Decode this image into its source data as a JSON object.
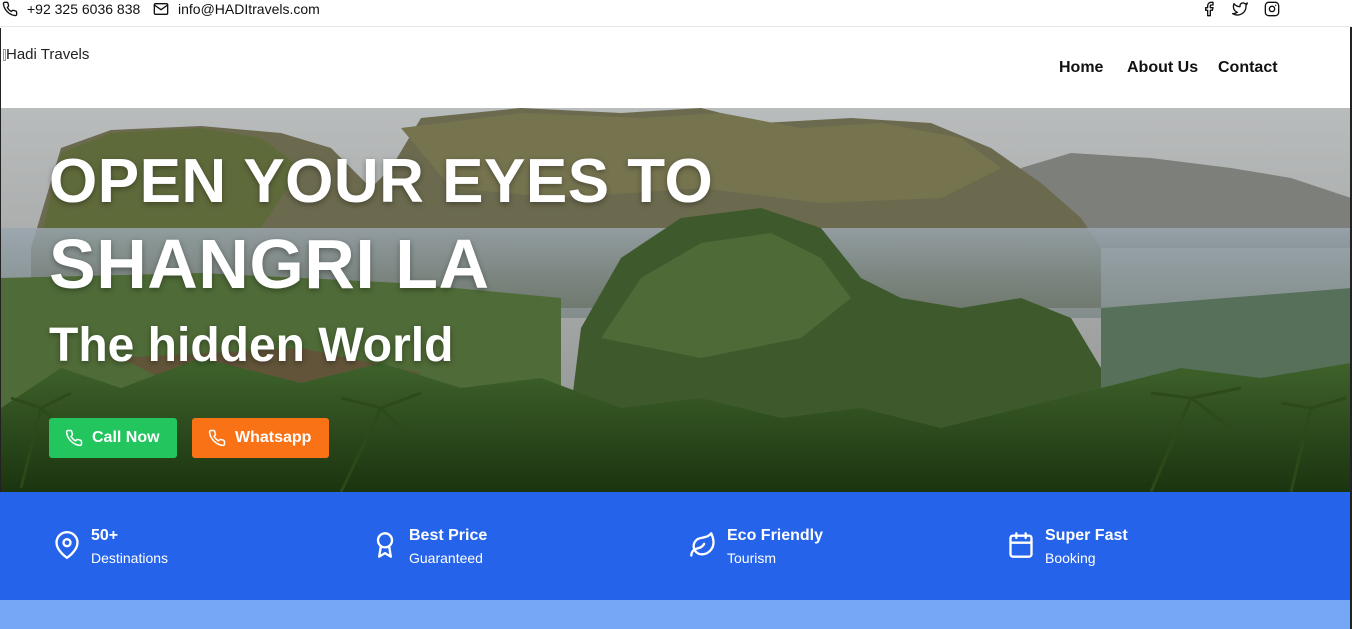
{
  "topbar": {
    "phone": "+92 325 6036 838",
    "email": "info@HADItravels.com",
    "icons": [
      "phone-icon",
      "mail-icon",
      "facebook-icon",
      "twitter-icon",
      "instagram-icon"
    ]
  },
  "header": {
    "logo_alt": "Hadi Travels",
    "nav": {
      "home": "Home",
      "about": "About Us",
      "contact": "Contact"
    }
  },
  "hero": {
    "title_line1": "OPEN YOUR EYES TO",
    "title_line2": "SHANGRI LA",
    "subtitle": "The hidden World",
    "call_button": "Call Now",
    "whatsapp_button": "Whatsapp"
  },
  "features": [
    {
      "icon": "map-pin-icon",
      "title": "50+",
      "subtitle": "Destinations"
    },
    {
      "icon": "award-icon",
      "title": "Best Price",
      "subtitle": "Guaranteed"
    },
    {
      "icon": "leaf-icon",
      "title": "Eco Friendly",
      "subtitle": "Tourism"
    },
    {
      "icon": "calendar-icon",
      "title": "Super Fast",
      "subtitle": "Booking"
    }
  ],
  "colors": {
    "feature_band": "#2563eb",
    "lower_band": "#75a7f7",
    "call_button": "#22c55e",
    "whatsapp_button": "#f97316"
  }
}
